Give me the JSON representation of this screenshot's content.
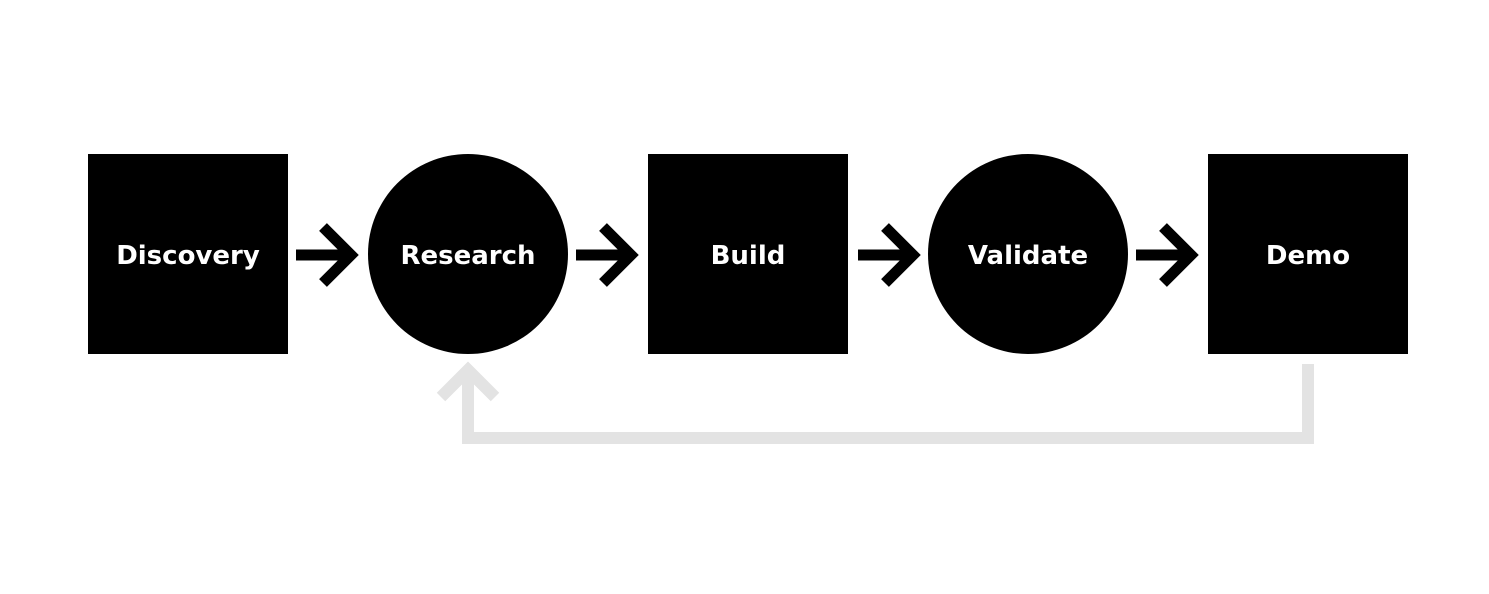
{
  "diagram": {
    "nodes": [
      {
        "id": "discovery",
        "label": "Discovery",
        "shape": "square"
      },
      {
        "id": "research",
        "label": "Research",
        "shape": "circle"
      },
      {
        "id": "build",
        "label": "Build",
        "shape": "square"
      },
      {
        "id": "validate",
        "label": "Validate",
        "shape": "circle"
      },
      {
        "id": "demo",
        "label": "Demo",
        "shape": "square"
      }
    ],
    "edges": [
      {
        "from": "discovery",
        "to": "research"
      },
      {
        "from": "research",
        "to": "build"
      },
      {
        "from": "build",
        "to": "validate"
      },
      {
        "from": "validate",
        "to": "demo"
      },
      {
        "from": "demo",
        "to": "research",
        "style": "feedback-loop"
      }
    ],
    "colors": {
      "node": "#000000",
      "text": "#ffffff",
      "arrow": "#000000",
      "feedback": "#e3e3e3"
    }
  }
}
